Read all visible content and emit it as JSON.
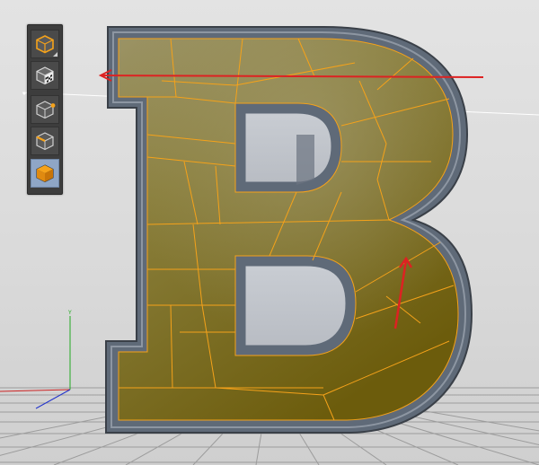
{
  "viewport": {
    "label": "3D viewport",
    "background": "#dadada",
    "axis_colors": {
      "x": "#cc2222",
      "y": "#22aa22",
      "z": "#2233cc"
    }
  },
  "model": {
    "glyph": "B",
    "face_color": "#7d6d1d",
    "bevel_color": "#5f6a78",
    "edge_color": "#f5a21a"
  },
  "toolbar": {
    "tools": [
      {
        "name": "model-mode",
        "icon": "cube-orange-outline-icon",
        "active": false
      },
      {
        "name": "texture-mode",
        "icon": "checker-cube-icon",
        "active": false
      },
      {
        "name": "point-mode",
        "icon": "cube-point-icon",
        "active": false
      },
      {
        "name": "edge-mode",
        "icon": "cube-edge-icon",
        "active": false
      },
      {
        "name": "polygon-mode",
        "icon": "cube-polygon-icon",
        "active": true
      }
    ]
  },
  "annotations": {
    "arrow_color": "#dd2222"
  }
}
